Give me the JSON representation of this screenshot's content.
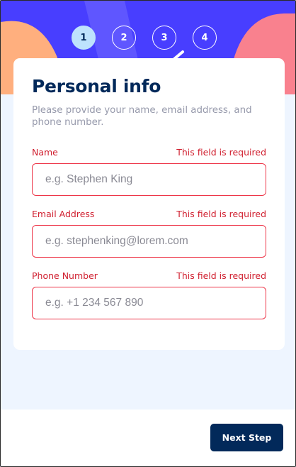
{
  "steps": [
    "1",
    "2",
    "3",
    "4"
  ],
  "active_step": 1,
  "colors": {
    "hero": "#483eff",
    "accent": "#02295a",
    "error": "#ed3548",
    "active_step": "#bee2fd"
  },
  "form": {
    "title": "Personal info",
    "subtitle": "Please provide your name, email address, and phone number.",
    "fields": [
      {
        "label": "Name",
        "error": "This field is required",
        "placeholder": "e.g. Stephen King",
        "value": ""
      },
      {
        "label": "Email Address",
        "error": "This field is required",
        "placeholder": "e.g. stephenking@lorem.com",
        "value": ""
      },
      {
        "label": "Phone Number",
        "error": "This field is required",
        "placeholder": "e.g. +1 234 567 890",
        "value": ""
      }
    ]
  },
  "footer": {
    "next_label": "Next Step"
  }
}
